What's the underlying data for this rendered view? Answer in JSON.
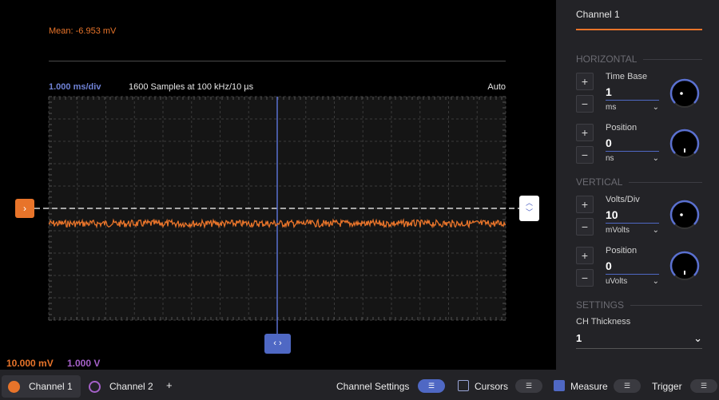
{
  "plot": {
    "mean_readout": "Mean: -6.953 mV",
    "timebase": "1.000 ms/div",
    "samples": "1600 Samples at 100 kHz/10 µs",
    "trigger_mode": "Auto",
    "ch1_scale": "10.000 mV",
    "ch2_scale": "1.000 V",
    "offset_handle_icon": "chevron-right-icon",
    "trigger_handle_icon": "chevron-up-down-icon",
    "time_handle_icon": "chevron-left-right-icon"
  },
  "bottom_bar": {
    "channel1": "Channel 1",
    "channel2": "Channel 2",
    "add": "+",
    "channel_settings": "Channel Settings",
    "cursors": "Cursors",
    "measure": "Measure",
    "trigger": "Trigger"
  },
  "panel": {
    "tab": "Channel 1",
    "horizontal": "HORIZONTAL",
    "vertical": "VERTICAL",
    "settings": "SETTINGS",
    "plus": "+",
    "minus": "−",
    "time_base": {
      "label": "Time Base",
      "value": "1",
      "unit": "ms"
    },
    "h_position": {
      "label": "Position",
      "value": "0",
      "unit": "ns"
    },
    "volts_div": {
      "label": "Volts/Div",
      "value": "10",
      "unit": "mVolts"
    },
    "v_position": {
      "label": "Position",
      "value": "0",
      "unit": "uVolts"
    },
    "ch_thickness": {
      "label": "CH Thickness",
      "value": "1"
    }
  },
  "colors": {
    "ch1": "#e8742a",
    "ch2": "#a561c9",
    "accent": "#4f68c4",
    "grid": "#3a3a3a"
  }
}
